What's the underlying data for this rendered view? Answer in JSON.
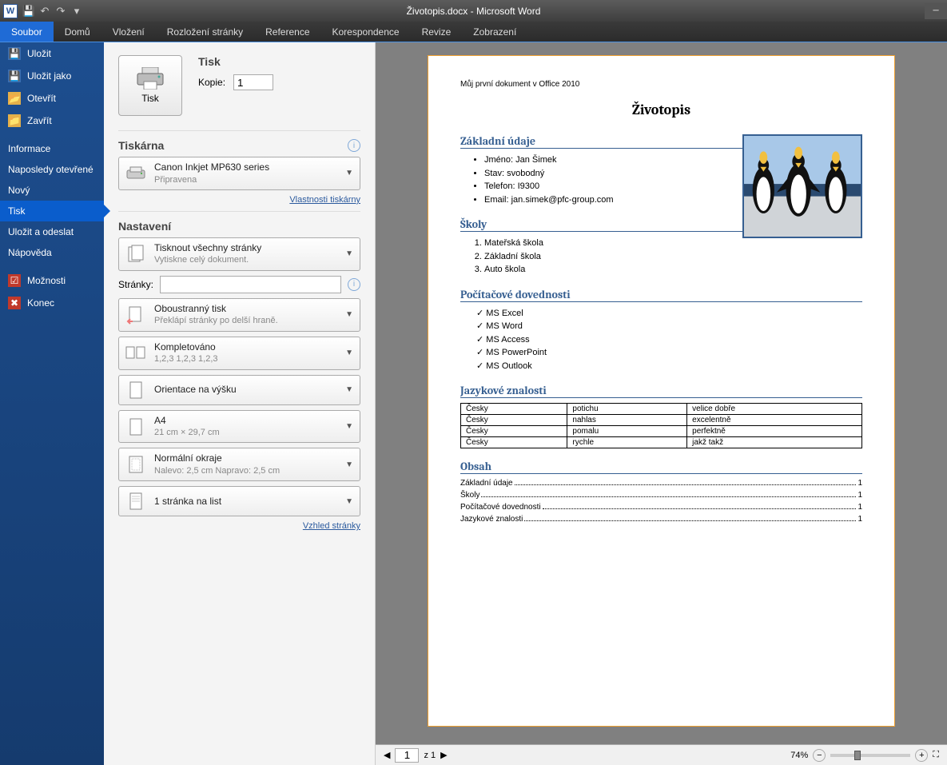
{
  "title": "Životopis.docx - Microsoft Word",
  "qat": {
    "save": "💾",
    "undo": "↶",
    "redo": "↷",
    "more": "▾"
  },
  "ribbon": [
    "Soubor",
    "Domů",
    "Vložení",
    "Rozložení stránky",
    "Reference",
    "Korespondence",
    "Revize",
    "Zobrazení"
  ],
  "ribbon_active": 0,
  "sidebar": [
    {
      "label": "Uložit",
      "icon": "save"
    },
    {
      "label": "Uložit jako",
      "icon": "saveas"
    },
    {
      "label": "Otevřít",
      "icon": "folder"
    },
    {
      "label": "Zavřít",
      "icon": "folder"
    },
    {
      "label": "Informace"
    },
    {
      "label": "Naposledy otevřené"
    },
    {
      "label": "Nový"
    },
    {
      "label": "Tisk",
      "sel": true
    },
    {
      "label": "Uložit a odeslat"
    },
    {
      "label": "Nápověda"
    },
    {
      "label": "Možnosti",
      "icon": "opts"
    },
    {
      "label": "Konec",
      "icon": "exit"
    }
  ],
  "print": {
    "heading": "Tisk",
    "button": "Tisk",
    "copies_label": "Kopie:",
    "copies_value": "1",
    "printer_heading": "Tiskárna",
    "printer_name": "Canon Inkjet MP630 series",
    "printer_status": "Připravena",
    "printer_props": "Vlastnosti tiskárny",
    "settings_heading": "Nastavení",
    "opt_scope_t": "Tisknout všechny stránky",
    "opt_scope_s": "Vytiskne celý dokument.",
    "pages_label": "Stránky:",
    "pages_value": "",
    "opt_duplex_t": "Oboustranný tisk",
    "opt_duplex_s": "Překlápí stránky po delší hraně.",
    "opt_collate_t": "Kompletováno",
    "opt_collate_s": "1,2,3   1,2,3   1,2,3",
    "opt_orient_t": "Orientace na výšku",
    "opt_size_t": "A4",
    "opt_size_s": "21 cm × 29,7 cm",
    "opt_margin_t": "Normální okraje",
    "opt_margin_s": "Nalevo:  2,5 cm   Napravo:  2,5 cm",
    "opt_sheet_t": "1 stránka na list",
    "page_setup": "Vzhled stránky"
  },
  "doc": {
    "header": "Můj první dokument v Office 2010",
    "title": "Životopis",
    "s1": "Základní údaje",
    "s1_items": [
      "Jméno: Jan Šimek",
      "Stav: svobodný",
      "Telefon: I9300",
      "Email: jan.simek@pfc-group.com"
    ],
    "s2": "Školy",
    "s2_items": [
      "Mateřská škola",
      "Základní škola",
      "Auto škola"
    ],
    "s3": "Počítačové dovednosti",
    "s3_items": [
      "MS Excel",
      "MS Word",
      "MS Access",
      "MS PowerPoint",
      "MS Outlook"
    ],
    "s4": "Jazykové znalosti",
    "s4_rows": [
      [
        "Česky",
        "potichu",
        "velice dobře"
      ],
      [
        "Česky",
        "nahlas",
        "excelentně"
      ],
      [
        "Česky",
        "pomalu",
        "perfektně"
      ],
      [
        "Česky",
        "rychle",
        "jakž takž"
      ]
    ],
    "s5": "Obsah",
    "toc": [
      [
        "Základní údaje",
        "1"
      ],
      [
        "Školy",
        "1"
      ],
      [
        "Počítačové dovednosti",
        "1"
      ],
      [
        "Jazykové znalosti",
        "1"
      ]
    ]
  },
  "nav": {
    "prev": "◀",
    "next": "▶",
    "page": "1",
    "of_prefix": "z",
    "of_total": "1",
    "zoom": "74%",
    "minus": "−",
    "plus": "+"
  }
}
